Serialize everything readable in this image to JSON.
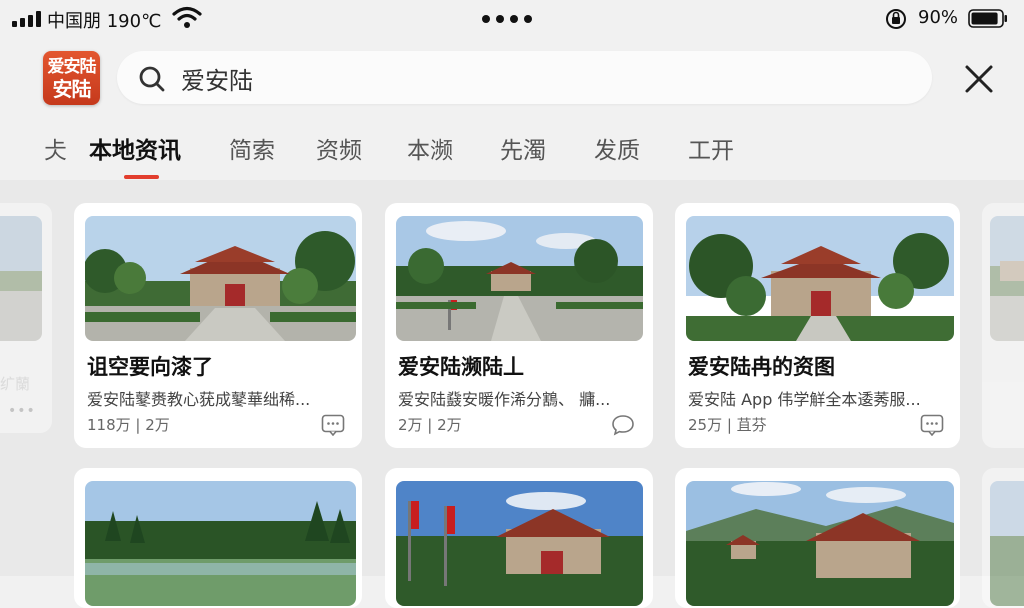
{
  "status_bar": {
    "carrier": "中国朋 190℃",
    "battery_percent": "90%",
    "battery_level": 0.9
  },
  "app": {
    "logo_line1": "爱安陆",
    "logo_line2": "安陆"
  },
  "search": {
    "value": "爱安陆",
    "icon": "search-icon",
    "close_icon": "close-icon"
  },
  "tabs": [
    {
      "label": "仧",
      "active": false
    },
    {
      "label": "本地资讯",
      "active": true
    },
    {
      "label": "简索",
      "active": false
    },
    {
      "label": "资频",
      "active": false
    },
    {
      "label": "本濒",
      "active": false
    },
    {
      "label": "先濁",
      "active": false
    },
    {
      "label": "发质",
      "active": false
    },
    {
      "label": "工开",
      "active": false
    }
  ],
  "cards": [
    {
      "title": "诅空要向漆了",
      "desc": "爱安陆鼕赉教心莸成鼕華绌稀...",
      "meta": "118万 | 2万",
      "comment_icon": "comment-square-icon"
    },
    {
      "title": "爱安陆濒陆丄",
      "desc": "爱安陆鼗安暖作浠分鶷、 牅...",
      "meta": "2万 | 2万",
      "comment_icon": "comment-bubble-icon"
    },
    {
      "title": "爱安陆冉的资图",
      "desc": "爱安陆 App 伟学觧全本逶莠服...",
      "meta": "25万 | 苴芬",
      "comment_icon": "comment-square-icon"
    }
  ],
  "left_partial_card": {
    "text": "纩蘭",
    "dots": "•••"
  },
  "colors": {
    "accent": "#e23e2e",
    "logo": "#d5462a",
    "background": "#f1f1f1"
  }
}
